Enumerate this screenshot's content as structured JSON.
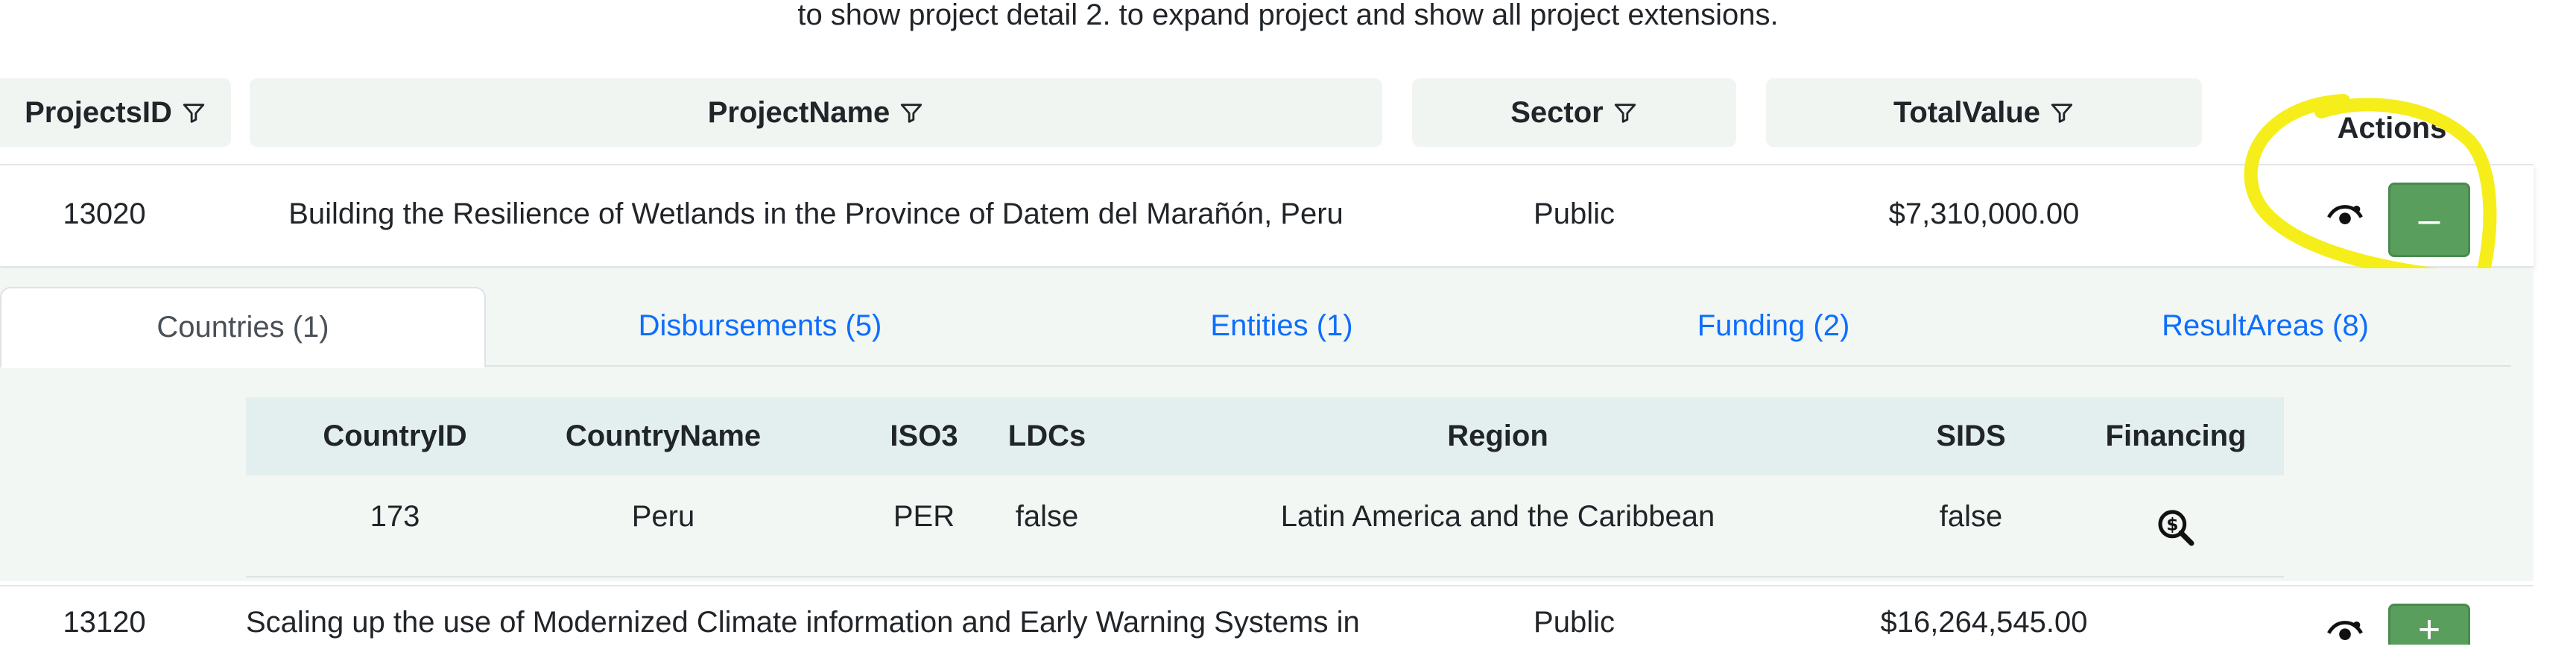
{
  "caption": "to show project detail 2. to expand project and show all project extensions.",
  "table": {
    "headers": {
      "projects_id": "ProjectsID",
      "project_name": "ProjectName",
      "sector": "Sector",
      "total_value": "TotalValue",
      "actions": "Actions"
    },
    "rows": [
      {
        "projects_id": "13020",
        "project_name": "Building the Resilience of Wetlands in the Province of Datem del Marañón, Peru",
        "sector": "Public",
        "total_value": "$7,310,000.00",
        "toggle_label": "–"
      },
      {
        "projects_id": "13120",
        "project_name": "Scaling up the use of Modernized Climate information and Early Warning Systems in",
        "sector": "Public",
        "total_value": "$16,264,545.00",
        "toggle_label": "+"
      }
    ]
  },
  "detail": {
    "tabs": [
      {
        "label": "Countries (1)",
        "active": true
      },
      {
        "label": "Disbursements (5)",
        "active": false
      },
      {
        "label": "Entities (1)",
        "active": false
      },
      {
        "label": "Funding (2)",
        "active": false
      },
      {
        "label": "ResultAreas (8)",
        "active": false
      }
    ],
    "countries": {
      "headers": [
        "CountryID",
        "CountryName",
        "ISO3",
        "LDCs",
        "Region",
        "SIDS",
        "Financing"
      ],
      "rows": [
        {
          "country_id": "173",
          "country_name": "Peru",
          "iso3": "PER",
          "ldcs": "false",
          "region": "Latin America and the Caribbean",
          "sids": "false"
        }
      ]
    }
  },
  "icons": {
    "filter": "filter-icon",
    "view": "eye-icon",
    "financing": "money-search-icon"
  },
  "colors": {
    "accent_green": "#5a9e5e",
    "link_blue": "#0d6efd",
    "highlight_yellow": "#f5ee1a",
    "header_bg": "#f1f5f2",
    "subtable_header_bg": "#e3efef"
  }
}
